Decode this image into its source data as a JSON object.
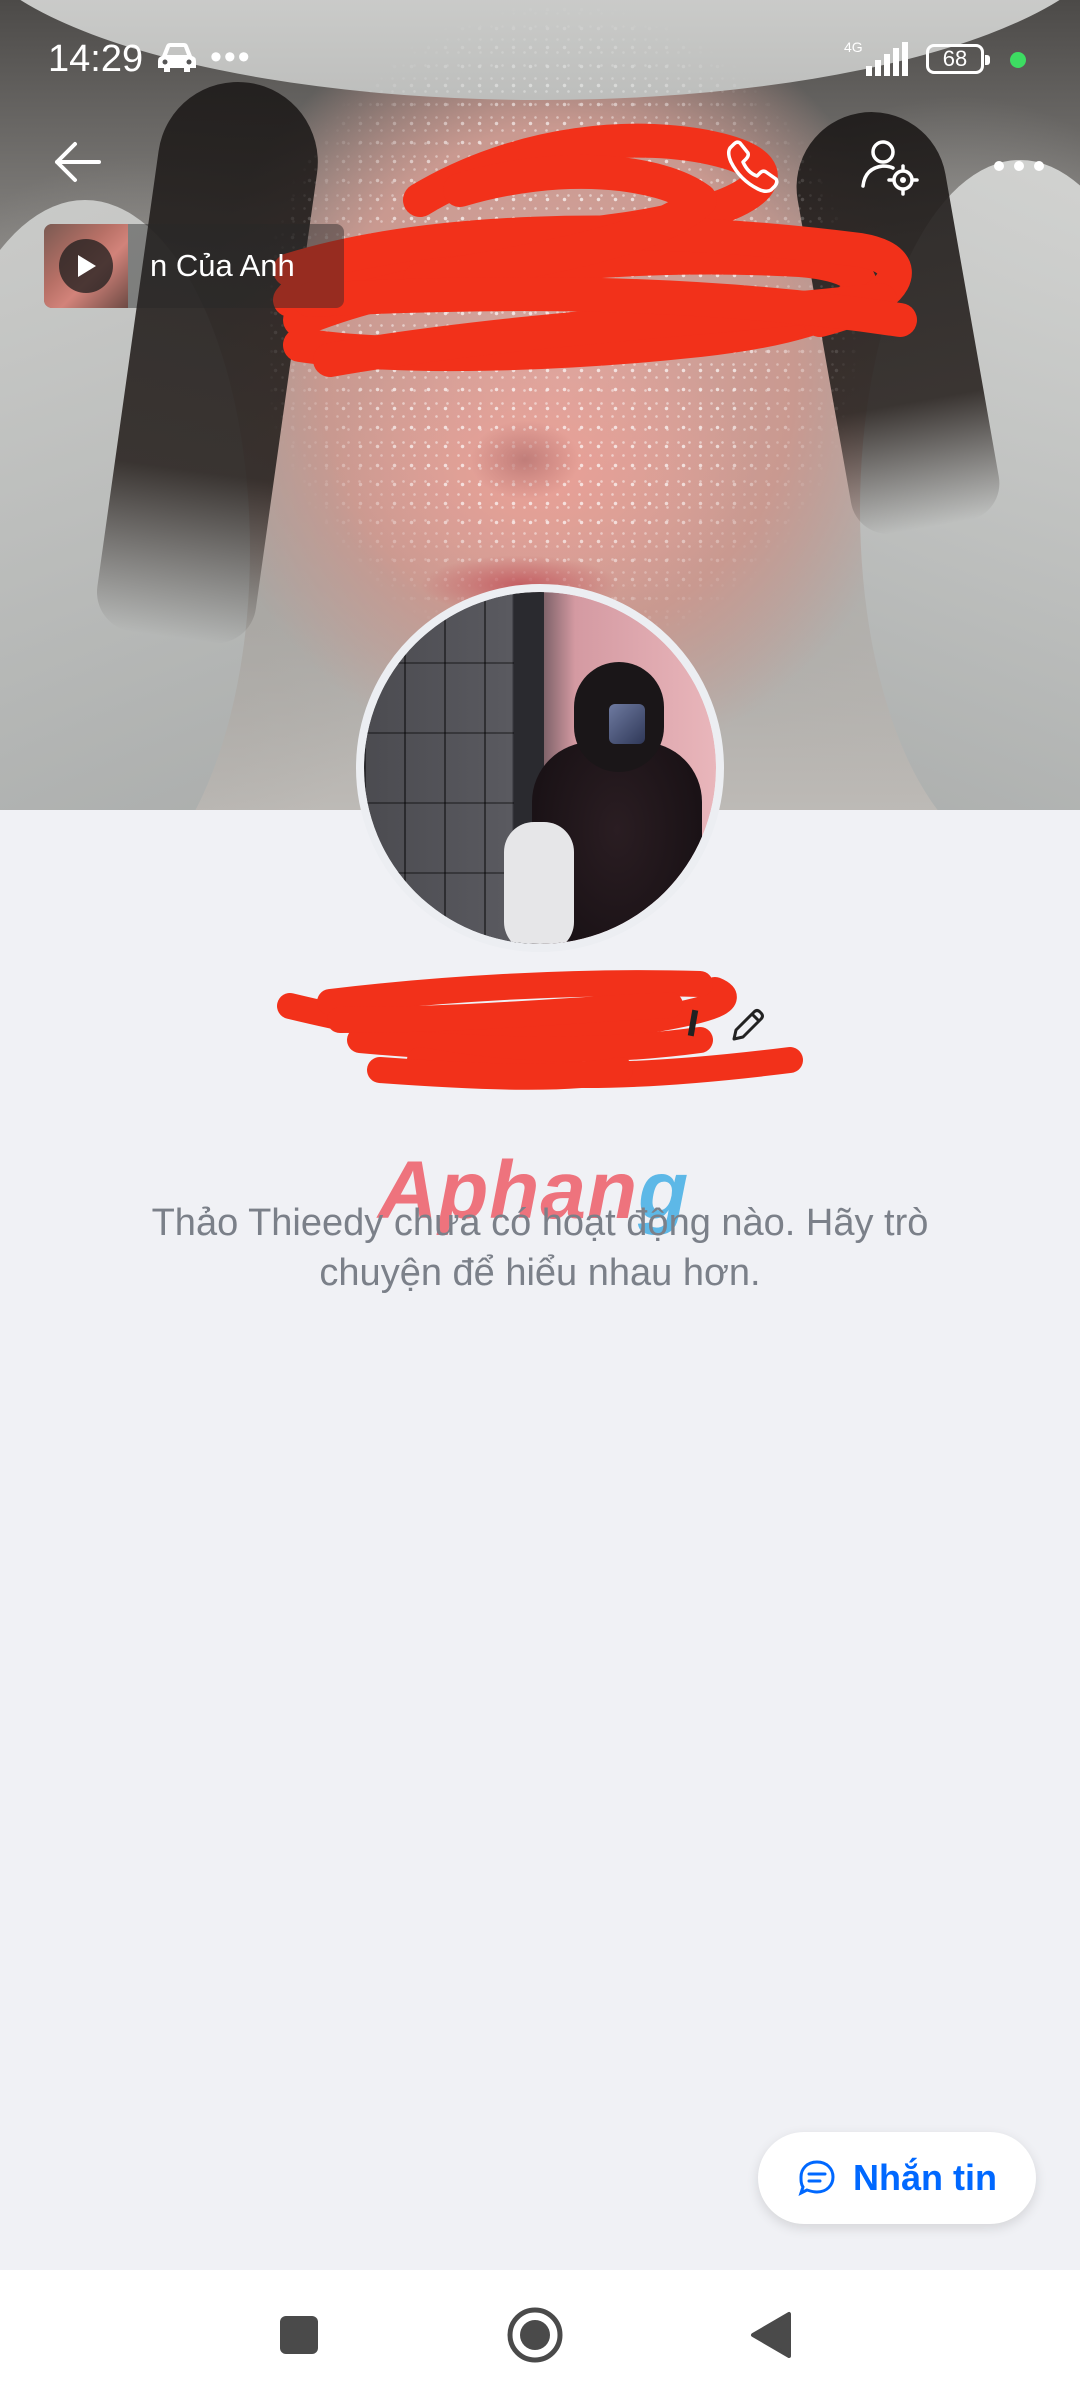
{
  "status_bar": {
    "time": "14:29",
    "overflow": "•••",
    "network": "4G",
    "battery": "68",
    "car_icon": "car-icon",
    "dot_color": "#3ddc62"
  },
  "toolbar": {
    "back_icon": "arrow-left-icon",
    "call_icon": "phone-icon",
    "settings_icon": "user-settings-icon",
    "more_icon": "more-horizontal-icon"
  },
  "music": {
    "title": "n Của Anh",
    "play_icon": "play-icon"
  },
  "profile": {
    "edit_icon": "pencil-icon",
    "empty_message": "Thảo Thieedy chưa có hoạt động nào. Hãy trò chuyện để hiểu nhau hơn."
  },
  "watermark": {
    "part1": "Aphan",
    "part2": "g"
  },
  "chat_button": {
    "label": "Nhắn tin",
    "icon": "chat-bubble-icon",
    "color": "#0068ff"
  },
  "nav": {
    "recents_icon": "square-icon",
    "home_icon": "circle-home-icon",
    "back_icon": "triangle-back-icon"
  },
  "colors": {
    "background": "#f0f1f5",
    "scribble": "#f2311a",
    "text_muted": "#7b8089"
  }
}
